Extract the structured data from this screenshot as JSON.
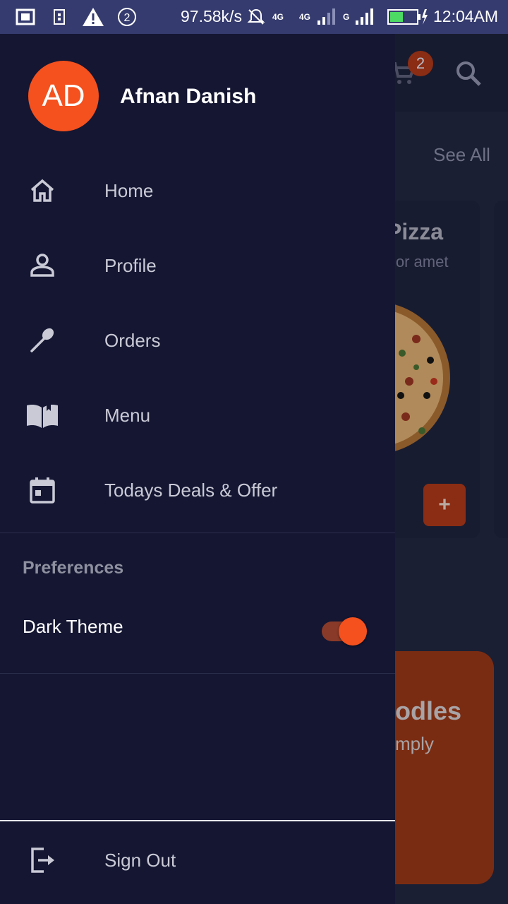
{
  "status_bar": {
    "network_speed": "97.58k/s",
    "notification_count": "2",
    "time": "12:04AM",
    "network_labels": [
      "4G",
      "4G",
      "G"
    ],
    "icons": [
      "screenshot-icon",
      "sim-icon",
      "warning-icon",
      "notification-count-icon",
      "mute-icon",
      "signal-icon",
      "battery-icon"
    ]
  },
  "background_app": {
    "cart_badge": "2",
    "see_all": "See All",
    "card_title": "Pizza",
    "card_subtitle": "lor amet",
    "add_button": "+",
    "banner_title": "odles",
    "banner_subtitle": "mply"
  },
  "drawer": {
    "avatar_initials": "AD",
    "user_name": "Afnan Danish",
    "nav_items": [
      {
        "label": "Home",
        "icon": "home-icon"
      },
      {
        "label": "Profile",
        "icon": "person-icon"
      },
      {
        "label": "Orders",
        "icon": "spoon-icon"
      },
      {
        "label": "Menu",
        "icon": "book-icon"
      },
      {
        "label": "Todays Deals & Offer",
        "icon": "calendar-icon"
      }
    ],
    "preferences_header": "Preferences",
    "dark_theme_label": "Dark Theme",
    "dark_theme_enabled": true,
    "sign_out_label": "Sign Out",
    "accent_color": "#f4511e"
  }
}
